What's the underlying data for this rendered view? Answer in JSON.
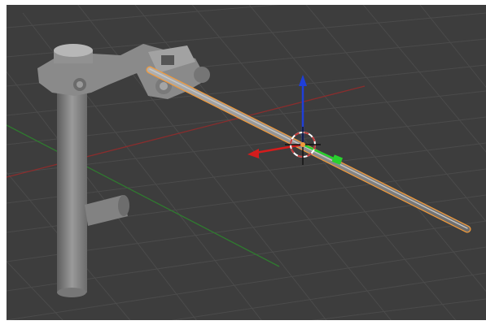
{
  "viewport": {
    "background": "#3d3d3d",
    "grid_color": "#4b4b4b",
    "x_axis_color": "#8a2d2d",
    "y_axis_color": "#2f7a2f"
  },
  "scene": {
    "model_color": "#8f8f8f",
    "selection_outline_color": "#f29a3a",
    "selected_object": "rod"
  },
  "gizmo": {
    "x_axis_color": "#d41c1c",
    "y_axis_color": "#29d12e",
    "z_axis_color": "#1f3fd8",
    "icons": [
      "3d-cursor-icon",
      "transform-gizmo-icon"
    ]
  }
}
